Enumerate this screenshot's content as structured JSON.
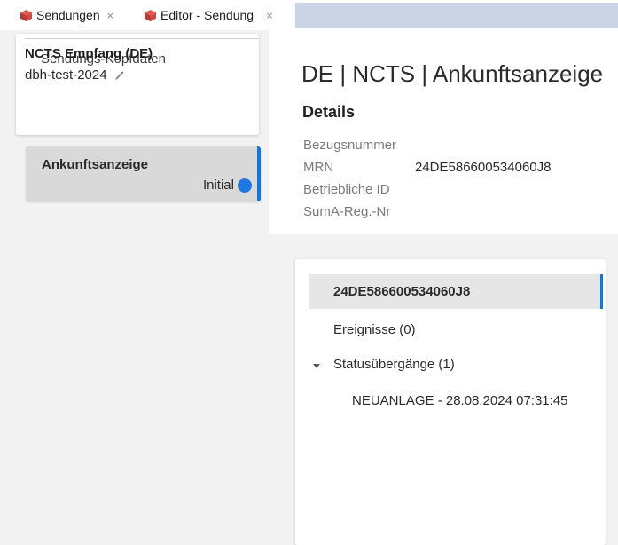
{
  "tabs": [
    {
      "label": "Sendungen",
      "icon": "cube-icon",
      "close": "×"
    },
    {
      "label": "Editor - Sendung",
      "icon": "cube-icon",
      "close": "×"
    }
  ],
  "header_card": {
    "title": "Sendungs-Kopfdaten",
    "name": "NCTS Empfang (DE)",
    "id": "dbh-test-2024"
  },
  "left_item": {
    "title": "Ankunftsanzeige",
    "status": "Initial"
  },
  "main": {
    "title": "DE | NCTS | Ankunftsanzeige",
    "details_heading": "Details",
    "fields": [
      {
        "label": "Bezugsnummer",
        "value": ""
      },
      {
        "label": "MRN",
        "value": "24DE586600534060J8"
      },
      {
        "label": "Betriebliche ID",
        "value": ""
      },
      {
        "label": "SumA-Reg.-Nr",
        "value": ""
      }
    ]
  },
  "tree": {
    "selected": "24DE586600534060J8",
    "events": "Ereignisse (0)",
    "status_transitions": "Statusübergänge (1)",
    "transition_item": "NEUANLAGE - 28.08.2024 07:31:45"
  },
  "colors": {
    "accent": "#1a73d6",
    "status_dot": "#1e78e0",
    "tab_strip": "#c9d3e3"
  }
}
